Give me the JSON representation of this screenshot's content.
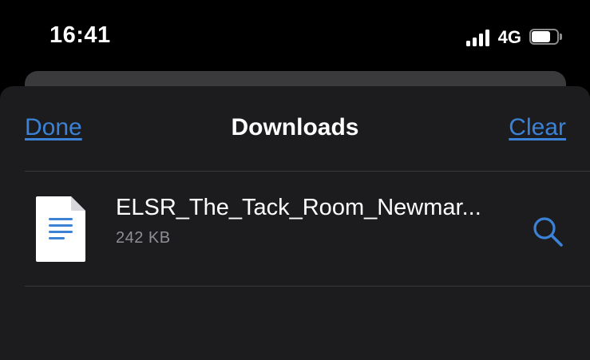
{
  "status_bar": {
    "time": "16:41",
    "network": "4G",
    "signal_icon": "cellular-signal-icon",
    "battery_icon": "battery-icon",
    "battery_level": 0.75
  },
  "nav": {
    "done_label": "Done",
    "title": "Downloads",
    "clear_label": "Clear"
  },
  "downloads": [
    {
      "file_name": "ELSR_The_Tack_Room_Newmar...",
      "file_size": "242 KB",
      "file_icon": "document-icon",
      "action_icon": "search-icon"
    }
  ],
  "colors": {
    "background": "#000000",
    "sheet": "#1c1c1e",
    "accent": "#3b82d6",
    "secondary_text": "#8e8e93",
    "separator": "#38383a"
  }
}
